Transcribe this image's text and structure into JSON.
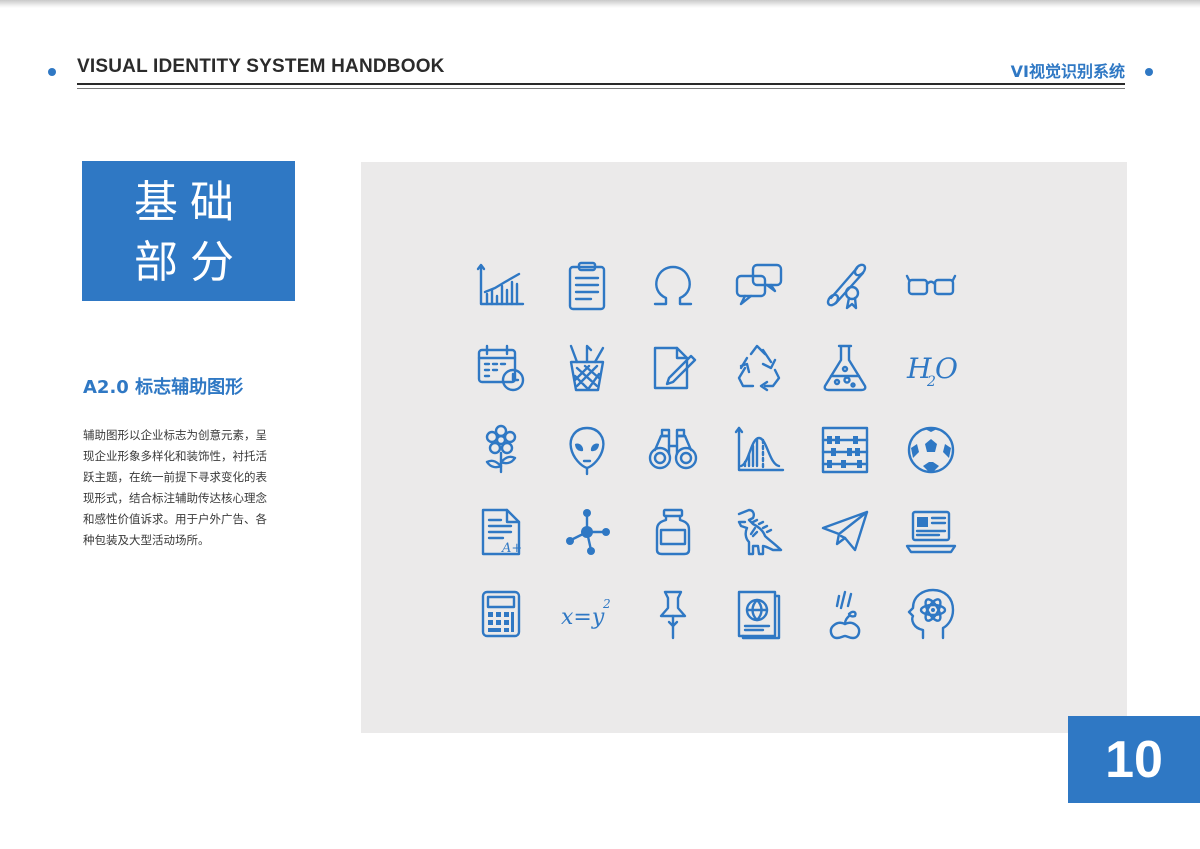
{
  "header": {
    "title": "VISUAL IDENTITY SYSTEM HANDBOOK",
    "subtitle": "VI视觉识别系统"
  },
  "section": {
    "line1": "基础",
    "line2": "部分"
  },
  "subheading": "A2.0  标志辅助图形",
  "description": [
    "辅助图形以企业标志为创意元素，呈",
    "现企业形象多样化和装饰性，衬托活",
    "跃主题，在统一前提下寻求变化的表",
    "现形式，结合标注辅助传达核心理念",
    "和感性价值诉求。用于户外广告、各",
    "种包装及大型活动场所。"
  ],
  "icons": [
    "bar-chart-icon",
    "clipboard-icon",
    "omega-icon",
    "speech-bubbles-icon",
    "diploma-scroll-icon",
    "glasses-icon",
    "calendar-clock-icon",
    "pencil-cup-icon",
    "document-pencil-icon",
    "recycle-icon",
    "flask-icon",
    "h2o-icon",
    "flower-icon",
    "alien-icon",
    "binoculars-icon",
    "bell-curve-icon",
    "abacus-icon",
    "soccer-ball-icon",
    "graded-paper-icon",
    "molecule-icon",
    "jar-icon",
    "dinosaur-icon",
    "paper-plane-icon",
    "laptop-icon",
    "calculator-icon",
    "equation-icon",
    "push-pin-icon",
    "globe-book-icon",
    "falling-apple-icon",
    "head-atom-icon"
  ],
  "icon_text": {
    "h2o": "H",
    "h2o_sub": "2",
    "h2o_o": "O",
    "equation": "x=y",
    "equation_sup": "2",
    "grade": "A+"
  },
  "page_number": "10",
  "colors": {
    "accent": "#2f78c4",
    "panel": "#ebeaea",
    "text": "#2b2b2b"
  }
}
